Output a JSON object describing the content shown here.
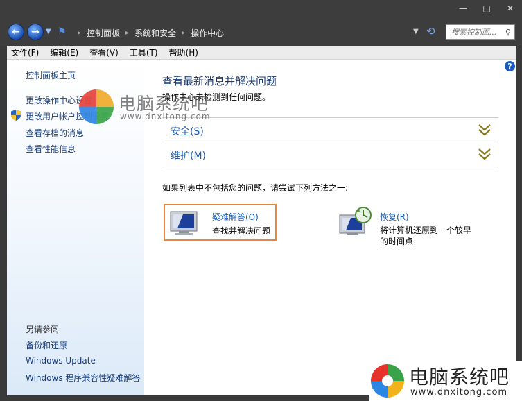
{
  "address_bar": {
    "crumbs": [
      "控制面板",
      "系统和安全",
      "操作中心"
    ],
    "search_placeholder": "搜索控制面..."
  },
  "menu": {
    "items": [
      "文件(F)",
      "编辑(E)",
      "查看(V)",
      "工具(T)",
      "帮助(H)"
    ]
  },
  "sidebar": {
    "home": "控制面板主页",
    "links": [
      "更改操作中心设置",
      "更改用户帐户控制设置",
      "查看存档的消息",
      "查看性能信息"
    ],
    "see_also_title": "另请参阅",
    "see_also": [
      "备份和还原",
      "Windows Update",
      "Windows 程序兼容性疑难解答"
    ]
  },
  "main": {
    "title": "查看最新消息并解决问题",
    "subtitle": "操作中心未检测到任何问题。",
    "sections": [
      "安全(S)",
      "维护(M)"
    ],
    "suggestion": "如果列表中不包括您的问题，请尝试下列方法之一:",
    "troubleshoot": {
      "title": "疑难解答(O)",
      "desc": "查找并解决问题"
    },
    "recovery": {
      "title": "恢复(R)",
      "desc": "将计算机还原到一个较早的时间点"
    }
  },
  "watermark": {
    "title": "电脑系统吧",
    "url": "www.dnxitong.com"
  },
  "colors": {
    "link": "#1e5cb3",
    "title_bar": "#3d3d3d",
    "highlight_border": "#e3893a"
  }
}
